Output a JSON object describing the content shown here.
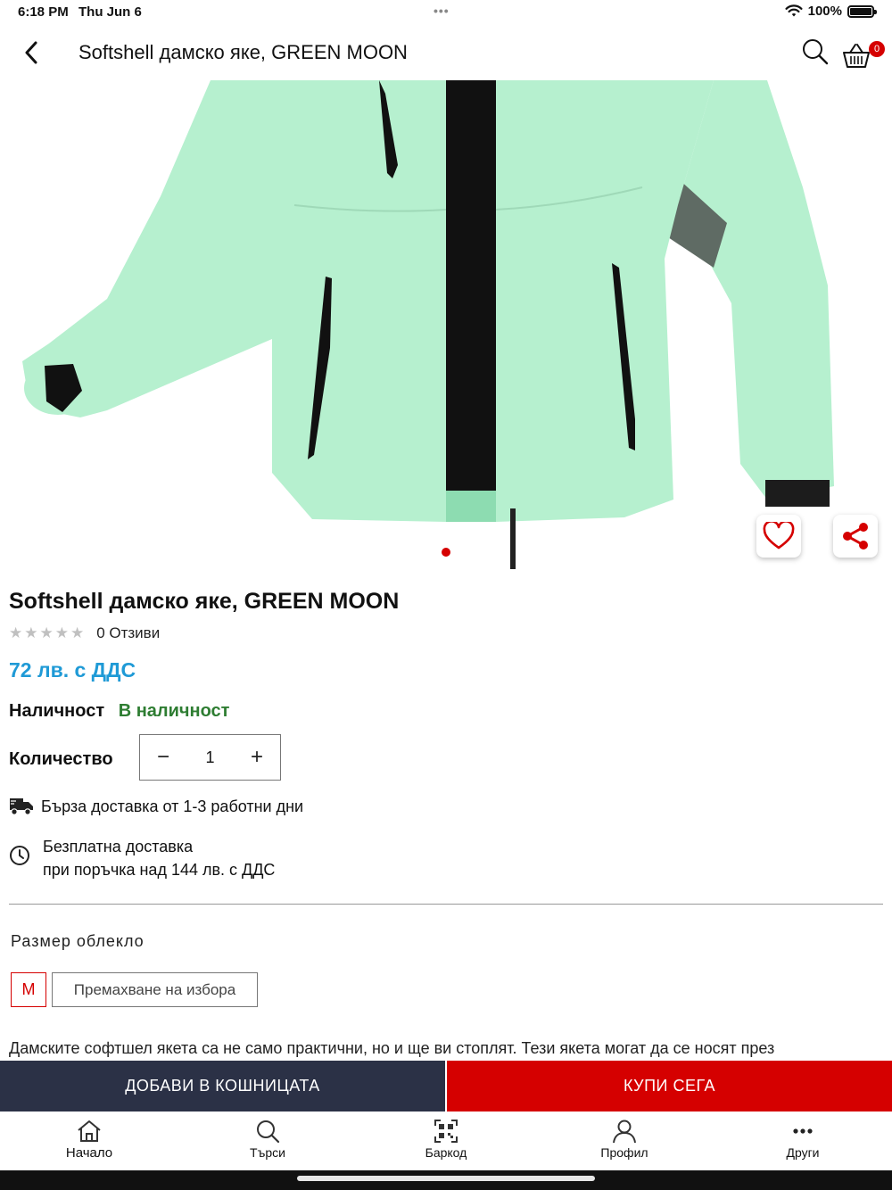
{
  "status_bar": {
    "time": "6:18 PM",
    "date": "Thu Jun 6",
    "battery": "100%"
  },
  "nav": {
    "title": "Softshell дамско яке, GREEN MOON",
    "cart_count": "0"
  },
  "product": {
    "title": "Softshell дамско яке, GREEN MOON",
    "stars": "★★★★★",
    "reviews": "0 Отзиви",
    "price": "72 лв. с ДДС",
    "availability_label": "Наличност",
    "availability_value": "В наличност",
    "quantity_label": "Количество",
    "quantity": "1",
    "quantity_minus": "−",
    "quantity_plus": "+",
    "delivery_fast": "Бърза доставка от 1-3 работни дни",
    "delivery_free_line1": "Безплатна доставка",
    "delivery_free_line2": "при поръчка над 144 лв. с ДДС",
    "size_label": "Размер облекло",
    "size_selected": "M",
    "clear_selection": "Премахване на избора",
    "description": "Дамските софтшел якета са не само практични, но и ще ви стоплят. Тези якета могат да се носят през"
  },
  "actions": {
    "add_to_cart": "ДОБАВИ  В КОШНИЦАТА",
    "buy_now": "КУПИ СЕГА"
  },
  "tabs": [
    {
      "label": "Начало",
      "icon": "home-icon"
    },
    {
      "label": "Търси",
      "icon": "search-icon"
    },
    {
      "label": "Баркод",
      "icon": "qr-code-icon"
    },
    {
      "label": "Профил",
      "icon": "profile-icon"
    },
    {
      "label": "Други",
      "icon": "more-icon"
    }
  ],
  "colors": {
    "accent_red": "#d50000",
    "price_blue": "#1f9ad6",
    "in_stock_green": "#2e7d32",
    "button_dark": "#2b3146",
    "jacket_mint": "#b6f0cf"
  }
}
